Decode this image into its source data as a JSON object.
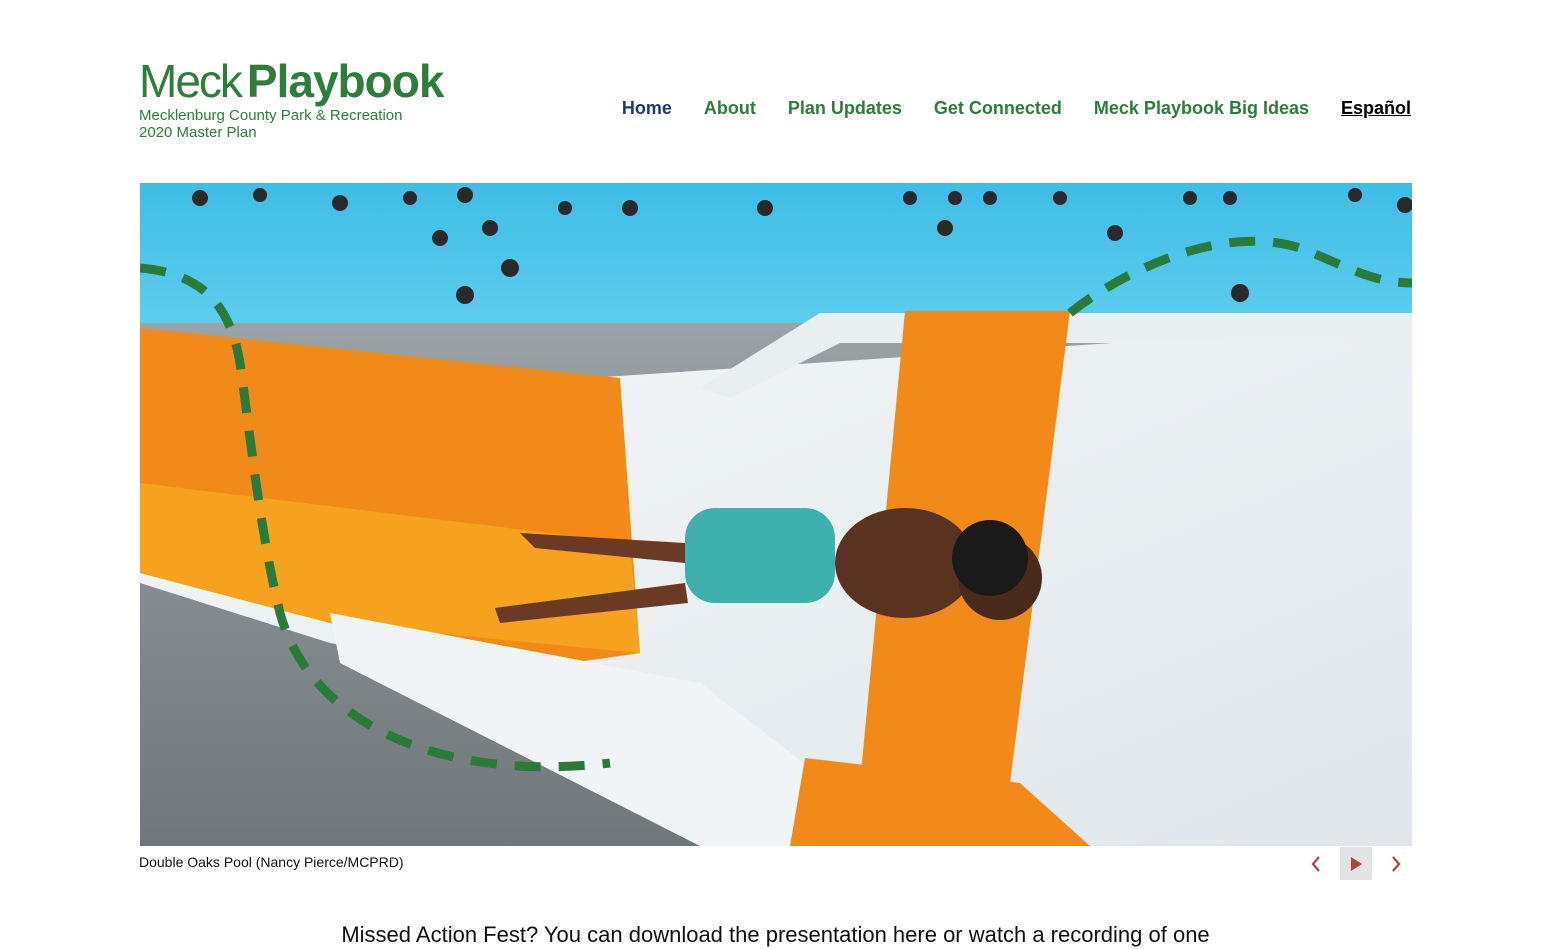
{
  "logo": {
    "word_light": "Meck",
    "word_bold": "Playbook",
    "subtitle_line1": "Mecklenburg County Park & Recreation",
    "subtitle_line2": "2020 Master Plan"
  },
  "nav": {
    "items": [
      {
        "label": "Home",
        "current": true
      },
      {
        "label": "About"
      },
      {
        "label": "Plan Updates"
      },
      {
        "label": "Get Connected"
      },
      {
        "label": "Meck Playbook Big Ideas"
      },
      {
        "label": "Español"
      }
    ]
  },
  "slideshow": {
    "caption": "Double Oaks Pool (Nancy Pierce/MCPRD)",
    "prev_icon": "chevron-left-icon",
    "play_icon": "play-icon",
    "next_icon": "chevron-right-icon"
  },
  "intro": {
    "text": "Missed Action Fest? You can download the presentation here or watch a recording of one"
  },
  "colors": {
    "brand_green": "#2e7d3c",
    "nav_active": "#1f3a73",
    "control_red": "#b0453c",
    "pool_blue": "#4fc7ea",
    "slide_orange": "#f28a1a"
  }
}
